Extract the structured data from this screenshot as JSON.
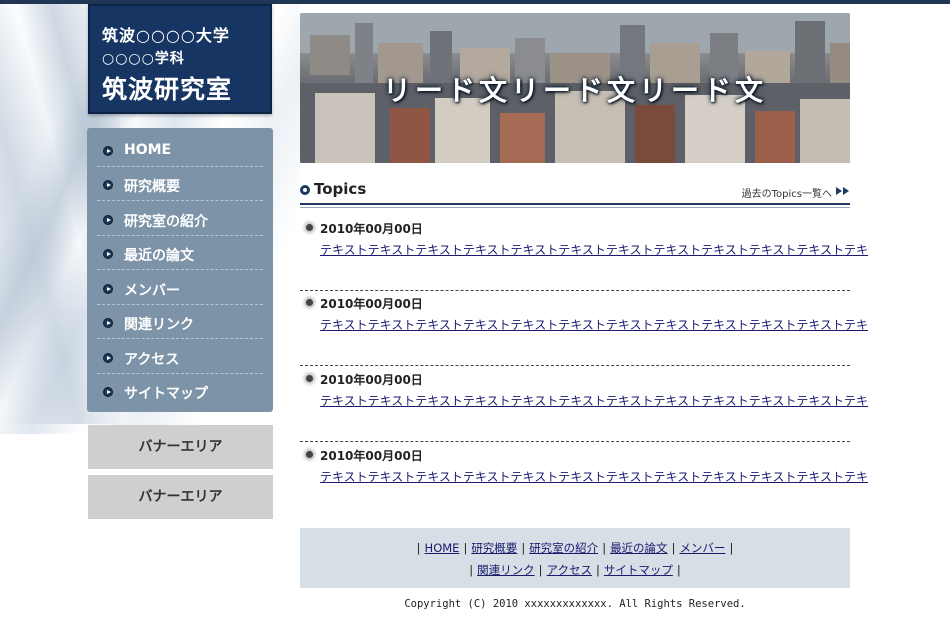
{
  "header": {
    "university": "筑波○○○○大学",
    "department": "○○○○学科",
    "lab_name": "筑波研究室"
  },
  "nav": {
    "items": [
      {
        "label": "HOME"
      },
      {
        "label": "研究概要"
      },
      {
        "label": "研究室の紹介"
      },
      {
        "label": "最近の論文"
      },
      {
        "label": "メンバー"
      },
      {
        "label": "関連リンク"
      },
      {
        "label": "アクセス"
      },
      {
        "label": "サイトマップ"
      }
    ]
  },
  "banners": [
    {
      "label": "バナーエリア"
    },
    {
      "label": "バナーエリア"
    }
  ],
  "hero": {
    "lead_text": "リード文リード文リード文"
  },
  "topics": {
    "heading": "Topics",
    "archive_link": "過去のTopics一覧へ",
    "entries": [
      {
        "date": "2010年00月00日",
        "text": "テキストテキストテキストテキストテキストテキストテキストテキストテキストテキストテキストテキ"
      },
      {
        "date": "2010年00月00日",
        "text": "テキストテキストテキストテキストテキストテキストテキストテキストテキストテキストテキストテキ"
      },
      {
        "date": "2010年00月00日",
        "text": "テキストテキストテキストテキストテキストテキストテキストテキストテキストテキストテキストテキ"
      },
      {
        "date": "2010年00月00日",
        "text": "テキストテキストテキストテキストテキストテキストテキストテキストテキストテキストテキストテキ"
      }
    ]
  },
  "footer": {
    "links_row1": [
      "HOME",
      "研究概要",
      "研究室の紹介",
      "最近の論文",
      "メンバー"
    ],
    "links_row2": [
      "関連リンク",
      "アクセス",
      "サイトマップ"
    ],
    "separator": "|",
    "copyright": "Copyright (C) 2010 xxxxxxxxxxxxx. All Rights Reserved."
  },
  "colors": {
    "navy": "#163563",
    "nav_bg": "#7d93a8",
    "banner_bg": "#cfcfcf",
    "footer_bg": "#d6dee6"
  },
  "icons": {
    "nav_bullet": "circle-arrow-icon",
    "topics_marker": "ring-icon",
    "archive_arrow": "double-arrow-icon",
    "entry_bullet": "dot-icon"
  }
}
